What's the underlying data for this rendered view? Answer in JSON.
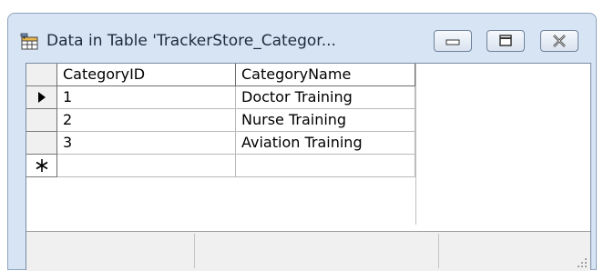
{
  "window": {
    "title": "Data in Table 'TrackerStore_Categor...",
    "controls": {
      "minimize_icon": "minimize-icon",
      "maximize_icon": "maximize-icon",
      "close_icon": "close-icon"
    },
    "app_icon": "table-icon"
  },
  "grid": {
    "columns": [
      "CategoryID",
      "CategoryName"
    ],
    "rows": [
      {
        "indicator": "current-row-arrow",
        "CategoryID": "1",
        "CategoryName": "Doctor Training"
      },
      {
        "indicator": "",
        "CategoryID": "2",
        "CategoryName": "Nurse Training"
      },
      {
        "indicator": "",
        "CategoryID": "3",
        "CategoryName": "Aviation Training"
      }
    ],
    "new_row_indicator": "asterisk"
  },
  "statusbar": {
    "panes": [
      "",
      "",
      ""
    ]
  },
  "colors": {
    "titlebar": "#d6e4f3",
    "selector": "#f0f0f0",
    "statusbar": "#f0f0f0"
  }
}
